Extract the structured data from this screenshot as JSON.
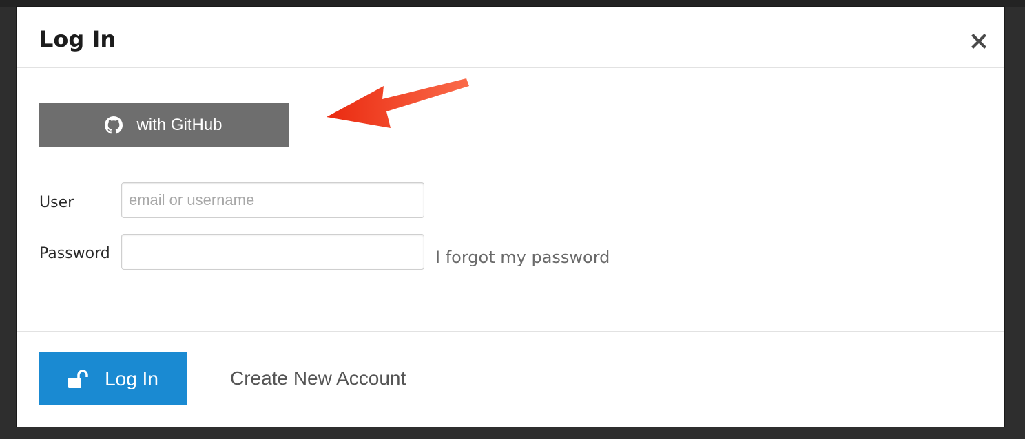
{
  "dialog": {
    "title": "Log In"
  },
  "github_button": {
    "label": "with GitHub",
    "icon": "github-icon",
    "color": "#6e6e6e"
  },
  "annotation": {
    "icon": "arrow-icon",
    "color": "#f0391c"
  },
  "form": {
    "user_label": "User",
    "user_placeholder": "email or username",
    "user_value": "",
    "password_label": "Password",
    "password_value": "",
    "forgot_link": "I forgot my password"
  },
  "footer": {
    "login_button": "Log In",
    "login_icon": "unlock-icon",
    "login_color": "#1a8ad2",
    "create_account": "Create New Account"
  }
}
